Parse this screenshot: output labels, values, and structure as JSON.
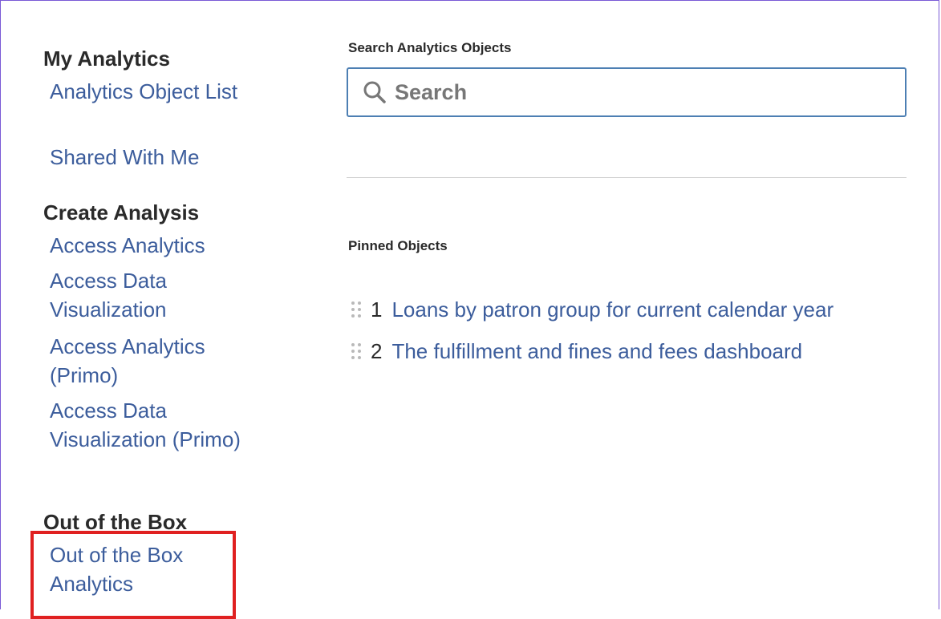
{
  "sidebar": {
    "my_analytics": {
      "heading": "My Analytics",
      "links": [
        "Analytics Object List",
        "Shared With Me"
      ]
    },
    "create_analysis": {
      "heading": "Create Analysis",
      "links": [
        "Access Analytics",
        "Access Data Visualization",
        "Access Analytics (Primo)",
        "Access Data Visualization (Primo)"
      ]
    },
    "out_of_the_box": {
      "heading": "Out of the Box",
      "links": [
        "Out of the Box Analytics"
      ]
    }
  },
  "main": {
    "search": {
      "label": "Search Analytics Objects",
      "placeholder": "Search",
      "icon": "search-icon"
    },
    "pinned": {
      "label": "Pinned Objects",
      "items": [
        {
          "num": "1",
          "title": "Loans by patron group for current calendar year"
        },
        {
          "num": "2",
          "title": "The fulfillment and fines and fees dashboard"
        }
      ]
    }
  },
  "colors": {
    "link": "#3c5d9c",
    "highlight": "#e02020",
    "search_border": "#4d7fb3",
    "frame": "#7a5ad6"
  }
}
